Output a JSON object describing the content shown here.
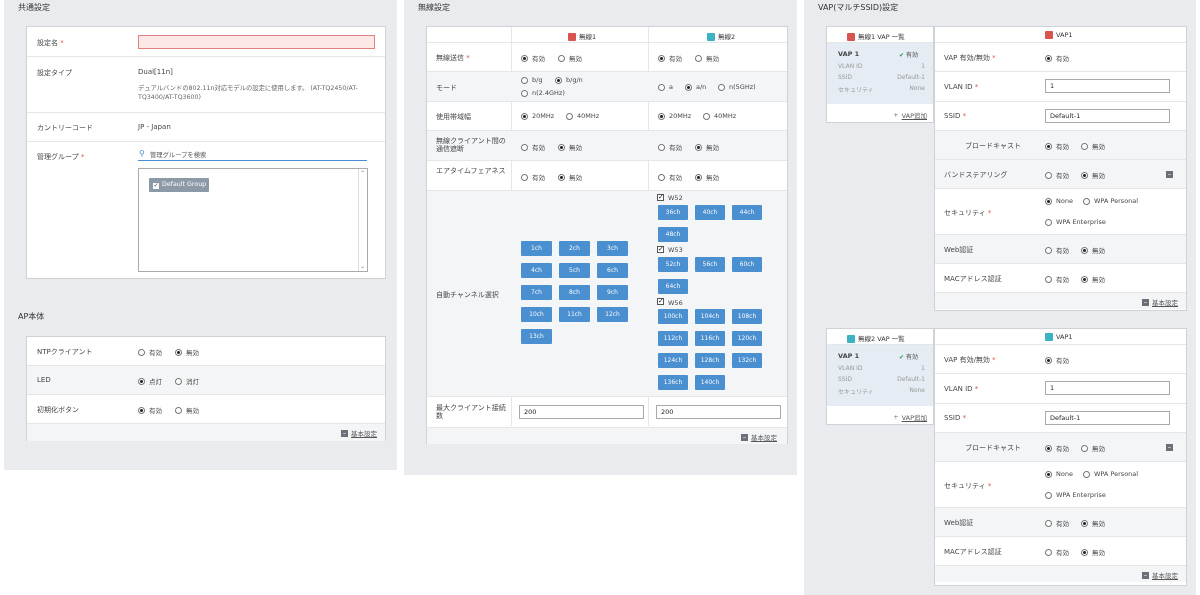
{
  "common": {
    "title": "共通設定",
    "name_label": "設定名",
    "type_label": "設定タイプ",
    "type_value": "Dual[11n]",
    "type_desc": "デュアルバンドの802.11n対応モデルの設定に使用します。 (AT-TQ2450/AT-TQ3400/AT-TQ3600)",
    "country_label": "カントリーコード",
    "country_value": "JP - Japan",
    "group_label": "管理グループ",
    "group_search": "管理グループを検索",
    "group_item": "Default Group"
  },
  "ap": {
    "title": "AP本体",
    "ntp_label": "NTPクライアント",
    "led_label": "LED",
    "reset_label": "初期化ボタン",
    "on": "有効",
    "off": "無効",
    "lit": "点灯",
    "unlit": "消灯",
    "basic": "基本設定"
  },
  "wireless": {
    "title": "無線設定",
    "w1": "無線1",
    "w2": "無線2",
    "tx_label": "無線送信",
    "mode_label": "モード",
    "bw_label": "使用帯域幅",
    "isolate_label": "無線クライアント間の通信遮断",
    "airtime_label": "エアタイムフェアネス",
    "channel_label": "自動チャンネル選択",
    "max_label": "最大クライアント接続数",
    "on": "有効",
    "off": "無効",
    "mode_bg": "b/g",
    "mode_bgn": "b/g/n",
    "mode_n24": "n(2.4GHz)",
    "mode_a": "a",
    "mode_an": "a/n",
    "mode_n5": "n(5GHz)",
    "bw20": "20MHz",
    "bw40": "40MHz",
    "ch24": [
      "1ch",
      "2ch",
      "3ch",
      "4ch",
      "5ch",
      "6ch",
      "7ch",
      "8ch",
      "9ch",
      "10ch",
      "11ch",
      "12ch",
      "13ch"
    ],
    "w52": "W52",
    "w53": "W53",
    "w56": "W56",
    "ch52": [
      "36ch",
      "40ch",
      "44ch",
      "48ch"
    ],
    "ch53": [
      "52ch",
      "56ch",
      "60ch",
      "64ch"
    ],
    "ch56": [
      "100ch",
      "104ch",
      "108ch",
      "112ch",
      "116ch",
      "120ch",
      "124ch",
      "128ch",
      "132ch",
      "136ch",
      "140ch"
    ],
    "max1": "200",
    "max2": "200",
    "basic": "基本設定"
  },
  "vap": {
    "title": "VAP(マルチSSID)設定",
    "list1": "無線1 VAP 一覧",
    "list2": "無線2 VAP 一覧",
    "vap_name": "VAP 1",
    "vap_status": "有効",
    "vlan_id_lbl": "VLAN ID",
    "vlan_id_val": "1",
    "ssid_lbl": "SSID",
    "ssid_val": "Default-1",
    "sec_lbl": "セキュリティ",
    "sec_val": "None",
    "add": "VAP追加",
    "head": "VAP1",
    "enable_label": "VAP 有効/無効",
    "vlan_label": "VLAN ID",
    "ssid_label": "SSID",
    "broadcast_label": "ブロードキャスト",
    "band_label": "バンドステアリング",
    "security_label": "セキュリティ",
    "web_label": "Web認証",
    "mac_label": "MACアドレス認証",
    "on": "有効",
    "off": "無効",
    "none": "None",
    "wpa_p": "WPA Personal",
    "wpa_e": "WPA Enterprise",
    "vlan_val": "1",
    "ssid_input": "Default-1",
    "basic": "基本設定"
  }
}
